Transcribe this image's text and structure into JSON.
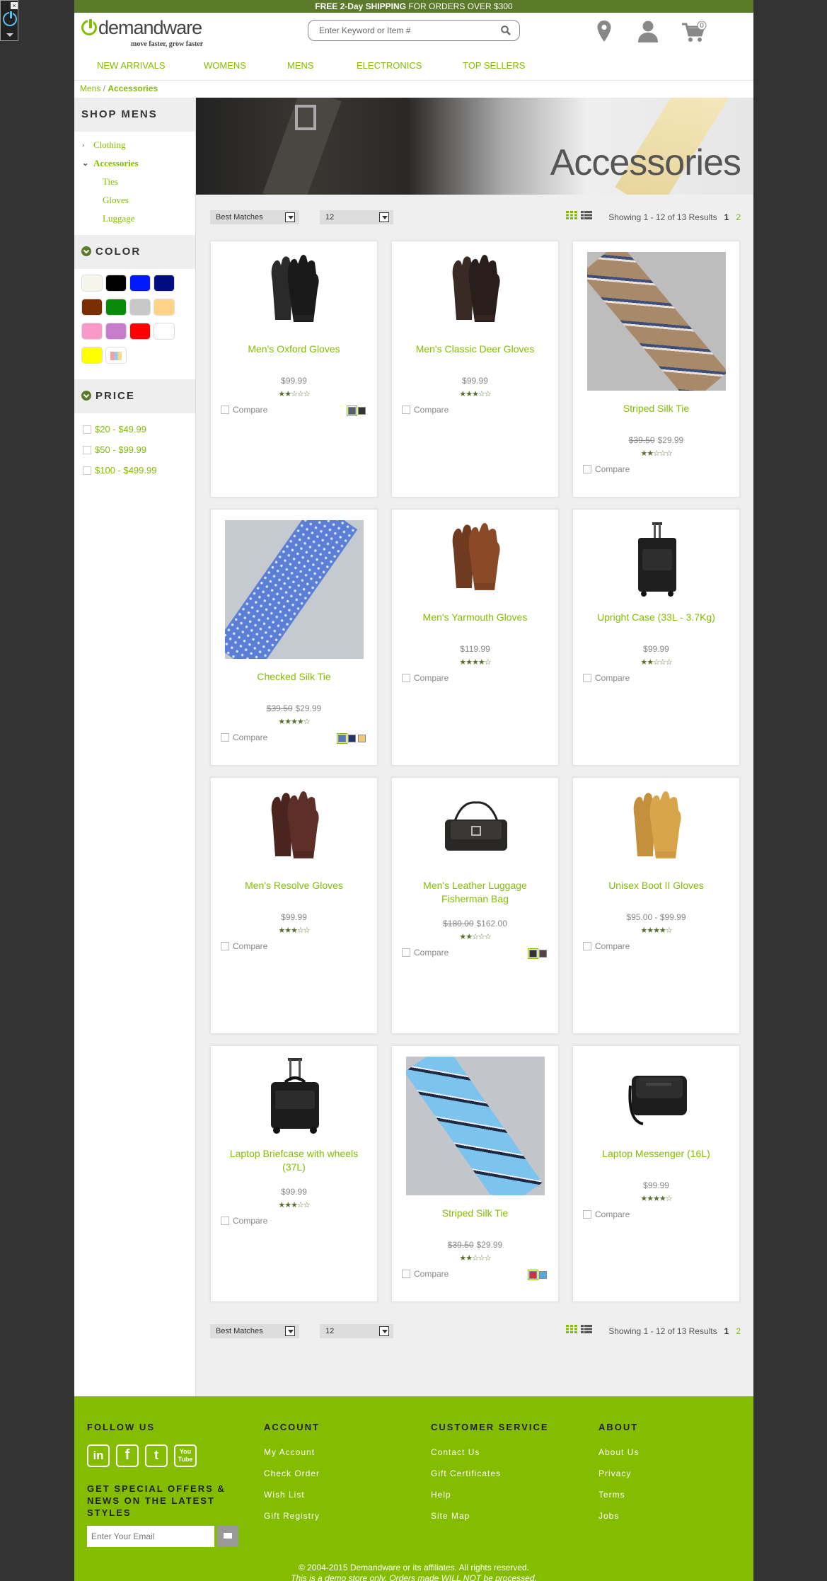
{
  "promo": {
    "bold": "FREE 2-Day SHIPPING",
    "rest": " FOR ORDERS OVER $300"
  },
  "logo": {
    "text": "demandware",
    "tagline": "move faster, grow faster"
  },
  "search": {
    "placeholder": "Enter Keyword or Item #"
  },
  "cart": {
    "count": "0"
  },
  "nav": [
    "NEW ARRIVALS",
    "WOMENS",
    "MENS",
    "ELECTRONICS",
    "TOP SELLERS"
  ],
  "breadcrumb": {
    "parent": "Mens",
    "sep": " / ",
    "current": "Accessories"
  },
  "sidebar": {
    "shop_title": "SHOP MENS",
    "categories": [
      {
        "label": "Clothing",
        "chevron": "›"
      },
      {
        "label": "Accessories",
        "chevron": "⌄"
      },
      {
        "label": "Ties"
      },
      {
        "label": "Gloves"
      },
      {
        "label": "Luggage"
      }
    ],
    "color_title": "COLOR",
    "colors": [
      "#f5f5ec",
      "#000000",
      "#0019ff",
      "#000c80",
      "#7a2e00",
      "#0a8a0a",
      "#c8c8c8",
      "#ffd388",
      "#f899c9",
      "#c77ccc",
      "#ff0000",
      "#ffffff",
      "#ffff00",
      "multi"
    ],
    "price_title": "PRICE",
    "prices": [
      "$20 - $49.99",
      "$50 - $99.99",
      "$100 - $499.99"
    ]
  },
  "banner": {
    "title": "Accessories"
  },
  "toolbar": {
    "sort": "Best Matches",
    "per_page": "12",
    "showing": "Showing 1 - 12 of 13 Results",
    "page_current": "1",
    "page_next": "2"
  },
  "compare_label": "Compare",
  "products": [
    {
      "name": "Men's Oxford Gloves",
      "old_price": "",
      "price": "$99.99",
      "stars": "★★☆☆☆",
      "image": "glove-black",
      "swatches": [
        "#55606a",
        "#333333"
      ]
    },
    {
      "name": "Men's Classic Deer Gloves",
      "old_price": "",
      "price": "$99.99",
      "stars": "★★★☆☆",
      "image": "glove-dark",
      "swatches": []
    },
    {
      "name": "Striped Silk Tie",
      "old_price": "$39.50",
      "price": "$29.99",
      "stars": "★★☆☆☆",
      "image": "tie-tan",
      "swatches": []
    },
    {
      "name": "Checked Silk Tie",
      "old_price": "$39.50",
      "price": "$29.99",
      "stars": "★★★★☆",
      "image": "tie-blue",
      "swatches": [
        "#5577bb",
        "#223366",
        "#eecc77"
      ]
    },
    {
      "name": "Men's Yarmouth Gloves",
      "old_price": "",
      "price": "$119.99",
      "stars": "★★★★☆",
      "image": "glove-brown",
      "swatches": []
    },
    {
      "name": "Upright Case (33L - 3.7Kg)",
      "old_price": "",
      "price": "$99.99",
      "stars": "★★☆☆☆",
      "image": "suitcase",
      "swatches": []
    },
    {
      "name": "Men's Resolve Gloves",
      "old_price": "",
      "price": "$99.99",
      "stars": "★★★☆☆",
      "image": "glove-maroon",
      "swatches": []
    },
    {
      "name": "Men's Leather Luggage Fisherman Bag",
      "old_price": "$180.00",
      "price": "$162.00",
      "stars": "★★☆☆☆",
      "image": "bag-leather",
      "swatches": [
        "#333333",
        "#554444"
      ]
    },
    {
      "name": "Unisex Boot II Gloves",
      "old_price": "",
      "price": "$95.00 - $99.99",
      "stars": "★★★★☆",
      "image": "glove-tan",
      "swatches": []
    },
    {
      "name": "Laptop Briefcase with wheels (37L)",
      "old_price": "",
      "price": "$99.99",
      "stars": "★★★☆☆",
      "image": "briefcase",
      "swatches": []
    },
    {
      "name": "Striped Silk Tie",
      "old_price": "$39.50",
      "price": "$29.99",
      "stars": "★★☆☆☆",
      "image": "tie-lightblue",
      "swatches": [
        "#cc3344",
        "#55aadd"
      ]
    },
    {
      "name": "Laptop Messenger (16L)",
      "old_price": "",
      "price": "$99.99",
      "stars": "★★★★☆",
      "image": "messenger",
      "swatches": []
    }
  ],
  "footer": {
    "follow": "FOLLOW US",
    "social": [
      "in",
      "f",
      "t",
      "You Tube"
    ],
    "offers": "GET SPECIAL OFFERS & NEWS ON THE LATEST STYLES",
    "email_placeholder": "Enter Your Email",
    "account": {
      "title": "ACCOUNT",
      "links": [
        "My Account",
        "Check Order",
        "Wish List",
        "Gift Registry"
      ]
    },
    "service": {
      "title": "CUSTOMER SERVICE",
      "links": [
        "Contact Us",
        "Gift Certificates",
        "Help",
        "Site Map"
      ]
    },
    "about": {
      "title": "ABOUT",
      "links": [
        "About Us",
        "Privacy",
        "Terms",
        "Jobs"
      ]
    },
    "copyright": "© 2004-2015 Demandware or its affiliates. All rights reserved.",
    "demo": "This is a demo store only. Orders made WILL NOT be processed."
  }
}
